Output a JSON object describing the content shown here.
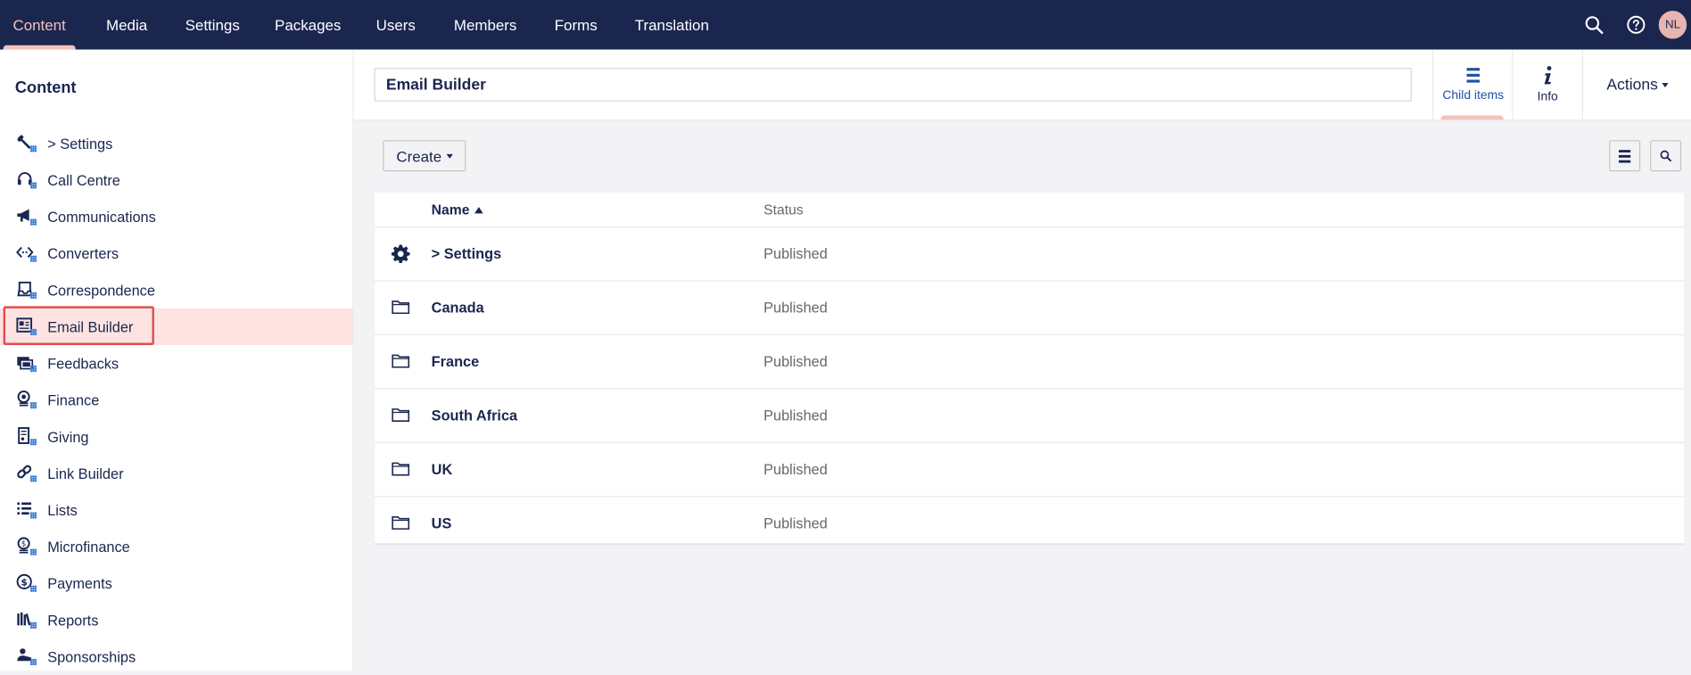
{
  "topnav": {
    "items": [
      {
        "label": "Content",
        "active": true
      },
      {
        "label": "Media"
      },
      {
        "label": "Settings"
      },
      {
        "label": "Packages"
      },
      {
        "label": "Users"
      },
      {
        "label": "Members"
      },
      {
        "label": "Forms"
      },
      {
        "label": "Translation"
      }
    ],
    "icons": [
      "search-icon",
      "help-icon"
    ],
    "avatar_initials": "NL"
  },
  "sidebar": {
    "title": "Content",
    "items": [
      {
        "label": "> Settings",
        "icon": "wrench-icon"
      },
      {
        "label": "Call Centre",
        "icon": "headset-icon"
      },
      {
        "label": "Communications",
        "icon": "megaphone-icon"
      },
      {
        "label": "Converters",
        "icon": "code-icon"
      },
      {
        "label": "Correspondence",
        "icon": "inbox-icon"
      },
      {
        "label": "Email Builder",
        "icon": "layout-icon",
        "selected": true
      },
      {
        "label": "Feedbacks",
        "icon": "comments-icon"
      },
      {
        "label": "Finance",
        "icon": "coins-icon"
      },
      {
        "label": "Giving",
        "icon": "receipt-icon"
      },
      {
        "label": "Link Builder",
        "icon": "link-icon"
      },
      {
        "label": "Lists",
        "icon": "list-icon"
      },
      {
        "label": "Microfinance",
        "icon": "coin-stack-icon"
      },
      {
        "label": "Payments",
        "icon": "dollar-coin-icon"
      },
      {
        "label": "Reports",
        "icon": "books-icon"
      },
      {
        "label": "Sponsorships",
        "icon": "handshake-icon"
      }
    ]
  },
  "editor": {
    "name_value": "Email Builder",
    "apps": [
      {
        "label": "Child items",
        "icon": "list-icon",
        "active": true
      },
      {
        "label": "Info",
        "icon": "info-icon"
      }
    ],
    "actions_label": "Actions"
  },
  "toolbar": {
    "create_label": "Create"
  },
  "list": {
    "columns": {
      "name": "Name",
      "status": "Status"
    },
    "rows": [
      {
        "name": "> Settings",
        "status": "Published",
        "icon": "gear-icon"
      },
      {
        "name": "Canada",
        "status": "Published",
        "icon": "folder-icon"
      },
      {
        "name": "France",
        "status": "Published",
        "icon": "folder-icon"
      },
      {
        "name": "South Africa",
        "status": "Published",
        "icon": "folder-icon"
      },
      {
        "name": "UK",
        "status": "Published",
        "icon": "folder-icon"
      },
      {
        "name": "US",
        "status": "Published",
        "icon": "folder-icon"
      }
    ]
  },
  "colors": {
    "topbar": "#1b264f",
    "accent": "#f5c1bc",
    "selected_bg": "#fde4e2",
    "highlight_border": "#e04d4d"
  }
}
